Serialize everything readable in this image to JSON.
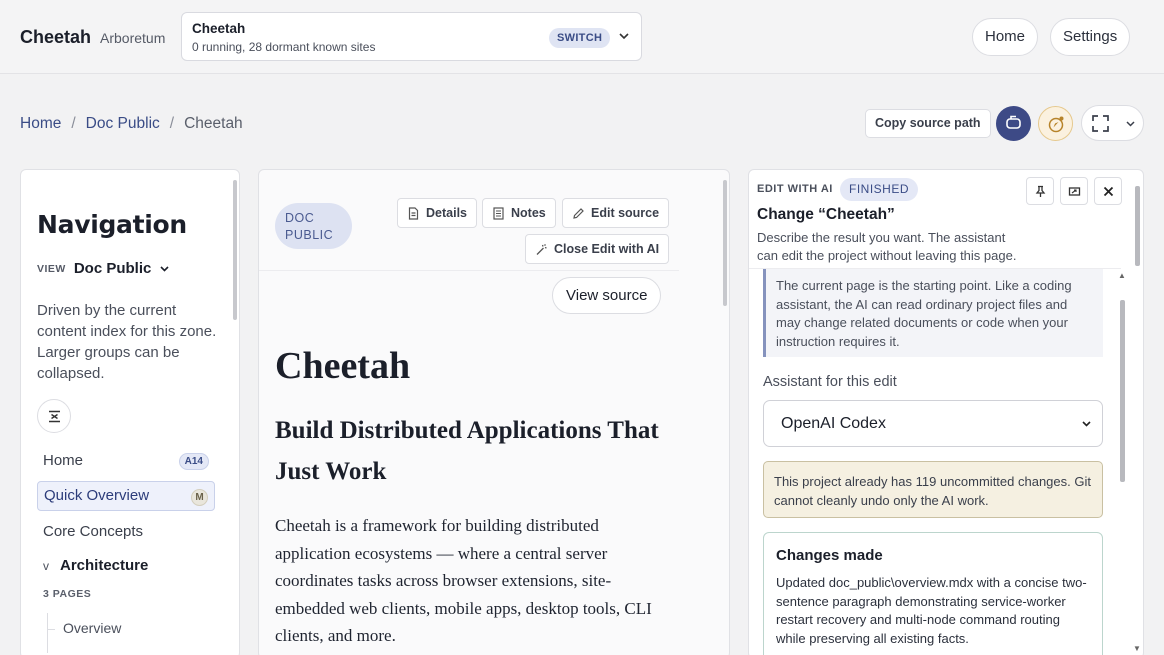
{
  "brand": {
    "name": "Cheetah",
    "sub": "Arboretum"
  },
  "project": {
    "title": "Cheetah",
    "status": "0 running, 28 dormant known sites",
    "switch_label": "SWITCH"
  },
  "topnav": {
    "home": "Home",
    "settings": "Settings"
  },
  "breadcrumb": {
    "items": [
      "Home",
      "Doc Public",
      "Cheetah"
    ],
    "separator": "/"
  },
  "toolbar": {
    "copy_source_path": "Copy source path"
  },
  "nav": {
    "title": "Navigation",
    "view_label": "VIEW",
    "view_value": "Doc Public",
    "description": "Driven by the current content index for this zone. Larger groups can be collapsed.",
    "items": [
      {
        "label": "Home",
        "badge": "A14"
      },
      {
        "label": "Quick Overview",
        "badge": "M",
        "active": true
      },
      {
        "label": "Core Concepts"
      }
    ],
    "group": {
      "label": "Architecture",
      "meta": "3 PAGES",
      "chevron": "v",
      "children": [
        "Overview"
      ]
    }
  },
  "doc": {
    "badge": "DOC PUBLIC",
    "tools": {
      "details": "Details",
      "notes": "Notes",
      "edit_source": "Edit source",
      "close_edit_ai": "Close Edit with AI"
    },
    "view_source": "View source",
    "title": "Cheetah",
    "subtitle": "Build Distributed Applications That Just Work",
    "paragraph": "Cheetah is a framework for building distributed application ecosystems — where a central server coordinates tasks across browser extensions, site-embedded web clients, mobile apps, desktop tools, CLI clients, and more."
  },
  "ai": {
    "label": "EDIT WITH AI",
    "status": "FINISHED",
    "title": "Change “Cheetah”",
    "description": "Describe the result you want. The assistant can edit the project without leaving this page.",
    "note": "The current page is the starting point. Like a coding assistant, the AI can read ordinary project files and may change related documents or code when your instruction requires it.",
    "assistant_label": "Assistant for this edit",
    "assistant_value": "OpenAI Codex",
    "warning": "This project already has 119 uncommitted changes. Git cannot cleanly undo only the AI work.",
    "changes_title": "Changes made",
    "changes_text": "Updated doc_public\\overview.mdx with a concise two-sentence paragraph demonstrating service-worker restart recovery and multi-node command routing while preserving all existing facts."
  },
  "colors": {
    "accent": "#3d4a86",
    "badge_bg": "#dfe4f3",
    "warning_bg": "#f5f0e1",
    "active_bg": "#eef1fb"
  }
}
